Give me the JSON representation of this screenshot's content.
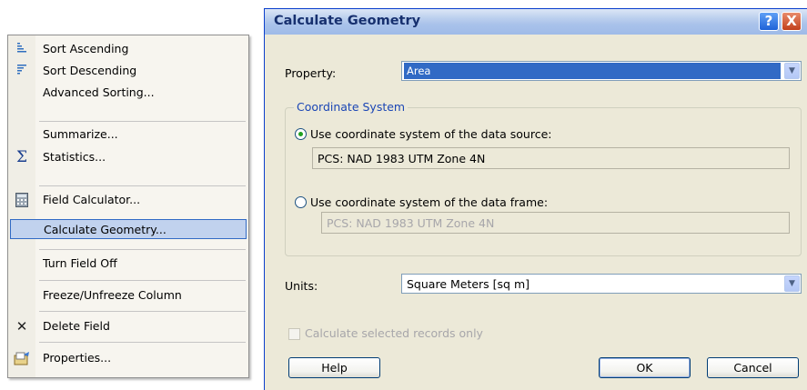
{
  "context_menu": {
    "items": [
      {
        "label": "Sort Ascending",
        "icon": "sort-ascending-icon"
      },
      {
        "label": "Sort Descending",
        "icon": "sort-descending-icon"
      },
      {
        "label": "Advanced Sorting...",
        "icon": ""
      },
      {
        "label": "Summarize...",
        "icon": ""
      },
      {
        "label": "Statistics...",
        "icon": "sigma-icon"
      },
      {
        "label": "Field Calculator...",
        "icon": "calculator-icon"
      },
      {
        "label": "Calculate Geometry...",
        "icon": "",
        "selected": true
      },
      {
        "label": "Turn Field Off",
        "icon": ""
      },
      {
        "label": "Freeze/Unfreeze Column",
        "icon": ""
      },
      {
        "label": "Delete Field",
        "icon": "delete-x-icon"
      },
      {
        "label": "Properties...",
        "icon": "properties-icon"
      }
    ]
  },
  "dialog": {
    "title": "Calculate Geometry",
    "help_glyph": "?",
    "close_glyph": "X",
    "property": {
      "label": "Property:",
      "value": "Area"
    },
    "coordinate_system": {
      "legend": "Coordinate System",
      "option_source": {
        "label": "Use coordinate system of the data source:",
        "value": "PCS: NAD 1983 UTM Zone 4N",
        "selected": true
      },
      "option_frame": {
        "label": "Use coordinate system of the data frame:",
        "value": "PCS: NAD 1983 UTM Zone 4N",
        "selected": false
      }
    },
    "units": {
      "label": "Units:",
      "value": "Square Meters [sq m]"
    },
    "selected_only": {
      "label": "Calculate selected records only",
      "checked": false,
      "enabled": false
    },
    "buttons": {
      "help": "Help",
      "ok": "OK",
      "cancel": "Cancel"
    }
  },
  "colors": {
    "menu_highlight": "#c1d2ee",
    "dialog_face": "#ece9d8",
    "title_text": "#17306f",
    "selection_blue": "#316ac5"
  }
}
